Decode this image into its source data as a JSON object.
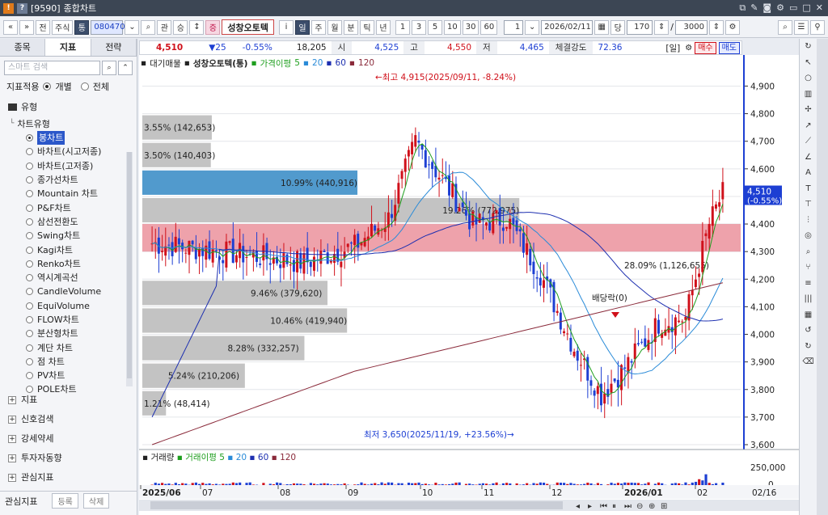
{
  "window": {
    "id": "[9590]",
    "title": "종합차트"
  },
  "toolbar": {
    "nav_prev": "«",
    "nav_next": "»",
    "btn_jeon": "전",
    "market": "주식",
    "btn_tong": "통",
    "code": "080470",
    "btn_gwan": "관",
    "btn_seung": "승",
    "stock_badge": "증",
    "stock_name": "성창오토텍",
    "btn_i": "i",
    "periods": [
      "일",
      "주",
      "월",
      "분",
      "틱",
      "년"
    ],
    "active_period": "일",
    "intervals": [
      "1",
      "3",
      "5",
      "10",
      "30",
      "60"
    ],
    "interval_value": "1",
    "date": "2026/02/11",
    "count": "170",
    "slash": "/",
    "total": "3000"
  },
  "left": {
    "tabs": [
      "종목",
      "지표",
      "전략"
    ],
    "active_tab": "지표",
    "search_placeholder": "스마트 검색",
    "scope_label": "지표적용",
    "scope_options": [
      "개별",
      "전체"
    ],
    "scope_selected": "개별",
    "folder_label": "유형",
    "subgroup": "차트유형",
    "chart_types": [
      "봉차트",
      "바차트(시고저종)",
      "바차트(고저종)",
      "종가선차트",
      "Mountain 차트",
      "P&F차트",
      "삼선전환도",
      "Swing차트",
      "Kagi차트",
      "Renko차트",
      "역시계곡선",
      "CandleVolume",
      "EquiVolume",
      "FLOW차트",
      "분산형차트",
      "계단 차트",
      "점 차트",
      "PV차트",
      "POLE차트"
    ],
    "selected_type": "봉차트",
    "groups": [
      "지표",
      "신호검색",
      "강세약세",
      "투자자동향",
      "관심지표"
    ],
    "bottom_label": "관심지표",
    "bottom_btn1": "등록",
    "bottom_btn2": "삭제"
  },
  "quote": {
    "price": "4,510",
    "change": "▼25",
    "pct": "-0.55%",
    "volume": "18,205",
    "open_label": "시",
    "open": "4,525",
    "high_label": "고",
    "high": "4,550",
    "low_label": "저",
    "low": "4,465",
    "strength_label": "체결강도",
    "strength": "72.36",
    "period_badge": "[일]",
    "buy": "매수",
    "sell": "매도"
  },
  "legend": {
    "mode": "대기매물",
    "name": "성창오토텍(통)",
    "ma_label": "가격이평",
    "ma": [
      "5",
      "20",
      "60",
      "120"
    ]
  },
  "vol_legend": {
    "name": "거래량",
    "ma_label": "거래이평",
    "ma": [
      "5",
      "20",
      "60",
      "120"
    ]
  },
  "colors": {
    "up": "#d0101a",
    "down": "#1d3fd3",
    "ma5": "#1e9e1e",
    "ma20": "#2a8bd8",
    "ma60": "#1d2fb0",
    "ma120": "#8a2a3a",
    "profile": "#bdbdbd",
    "profile_hi": "#3e8fc8",
    "band": "#e8838f"
  },
  "chart_data": {
    "type": "candlestick",
    "x_labels": [
      "2025/06",
      "07",
      "08",
      "09",
      "10",
      "11",
      "12",
      "2026/01",
      "02"
    ],
    "y_ticks": [
      3600,
      3700,
      3800,
      3900,
      4000,
      4100,
      4200,
      4300,
      4400,
      4500,
      4600,
      4700,
      4800,
      4900
    ],
    "ylim": [
      3600,
      4960
    ],
    "y_tick_labels": [
      "3,600",
      "3,700",
      "3,800",
      "3,900",
      "4,000",
      "4,100",
      "4,200",
      "4,300",
      "4,400",
      "4,500",
      "4,600",
      "4,700",
      "4,800",
      "4,900"
    ],
    "last_price_label": "4,510",
    "last_pct_label": "(-0.55%)",
    "max_annotation": "←최고 4,915(2025/09/11, -8.24%)",
    "min_annotation": "최저 3,650(2025/11/19, +23.56%)→",
    "dividend_label": "배당락(0)",
    "volume_profile": [
      {
        "label": "1.21% (48,414)",
        "pct": 1.21,
        "low": 3700,
        "high": 3800
      },
      {
        "label": "5.24% (210,206)",
        "pct": 5.24,
        "low": 3800,
        "high": 3900
      },
      {
        "label": "8.28% (332,257)",
        "pct": 8.28,
        "low": 3900,
        "high": 4000
      },
      {
        "label": "10.46% (419,940)",
        "pct": 10.46,
        "low": 4000,
        "high": 4100
      },
      {
        "label": "9.46% (379,620)",
        "pct": 9.46,
        "low": 4100,
        "high": 4200
      },
      {
        "label": "28.09% (1,126,655)",
        "pct": 28.09,
        "low": 4200,
        "high": 4300
      },
      {
        "label": "",
        "pct": 0,
        "low": 4300,
        "high": 4400
      },
      {
        "label": "19.26% (772,975)",
        "pct": 19.26,
        "low": 4400,
        "high": 4500
      },
      {
        "label": "10.99% (440,916)",
        "pct": 10.99,
        "low": 4500,
        "high": 4600
      },
      {
        "label": "3.50% (140,403)",
        "pct": 3.5,
        "low": 4600,
        "high": 4700
      },
      {
        "label": "3.55% (142,653)",
        "pct": 3.55,
        "low": 4700,
        "high": 4800
      }
    ],
    "price_band": [
      4300,
      4400
    ],
    "volume_ylim": [
      0,
      400000
    ],
    "volume_ticks": [
      "250,000",
      "0"
    ],
    "last_date": "02/16"
  }
}
